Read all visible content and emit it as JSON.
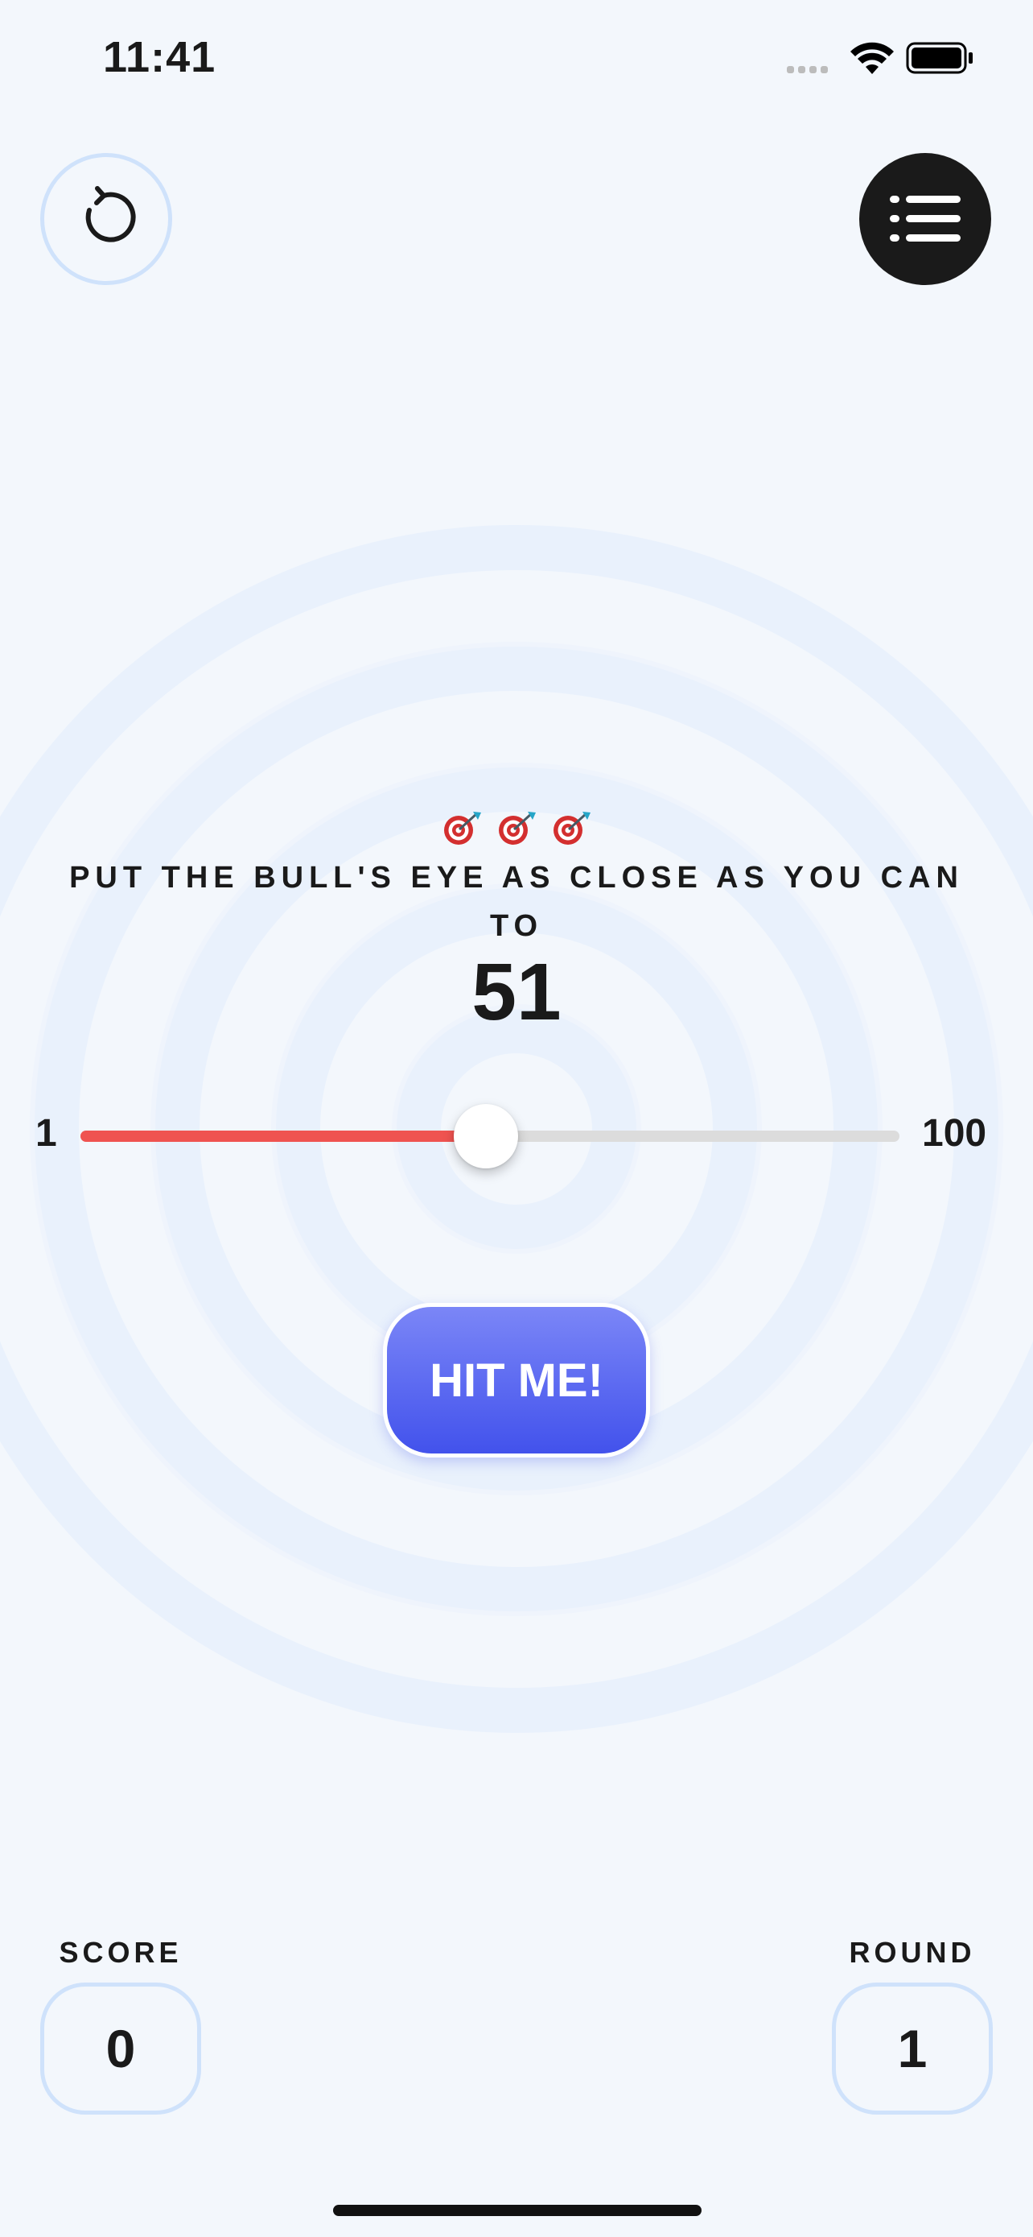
{
  "status_bar": {
    "time": "11:41"
  },
  "buttons": {
    "restart_icon": "restart-icon",
    "leaderboard_icon": "list-icon"
  },
  "game": {
    "bullseye_emojis": "🎯 🎯 🎯",
    "instruction": "PUT THE BULL'S EYE AS CLOSE AS YOU CAN TO",
    "target": "51",
    "slider": {
      "min_label": "1",
      "max_label": "100",
      "min": 1,
      "max": 100,
      "value": 50
    },
    "hit_button_label": "HIT ME!"
  },
  "stats": {
    "score_label": "SCORE",
    "score_value": "0",
    "round_label": "ROUND",
    "round_value": "1"
  },
  "colors": {
    "background": "#f3f7fc",
    "accent_red": "#ef5350",
    "button_gradient_top": "#7b86f7",
    "button_gradient_bottom": "#4252ec",
    "ring": "#e9f1fc",
    "border": "#cfe2fb"
  }
}
